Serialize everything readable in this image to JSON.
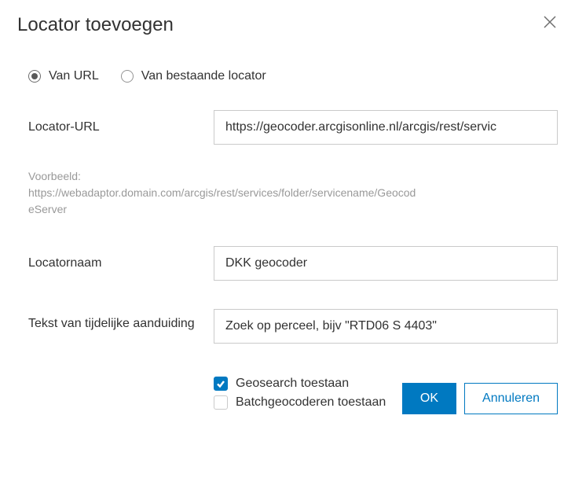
{
  "title": "Locator toevoegen",
  "sourceRadios": {
    "fromUrl": "Van URL",
    "fromExisting": "Van bestaande locator",
    "selected": "fromUrl"
  },
  "fields": {
    "url": {
      "label": "Locator-URL",
      "value": "https://geocoder.arcgisonline.nl/arcgis/rest/servic"
    },
    "example": {
      "label": "Voorbeeld:",
      "text": "https://webadaptor.domain.com/arcgis/rest/services/folder/servicename/GeocodeServer"
    },
    "name": {
      "label": "Locatornaam",
      "value": "DKK geocoder"
    },
    "placeholder": {
      "label": "Tekst van tijdelijke aanduiding",
      "value": "Zoek op perceel, bijv \"RTD06 S 4403\""
    },
    "geosearch": {
      "label": "Geosearch toestaan",
      "checked": true
    },
    "batch": {
      "label": "Batchgeocoderen toestaan",
      "checked": false
    }
  },
  "buttons": {
    "ok": "OK",
    "cancel": "Annuleren"
  }
}
